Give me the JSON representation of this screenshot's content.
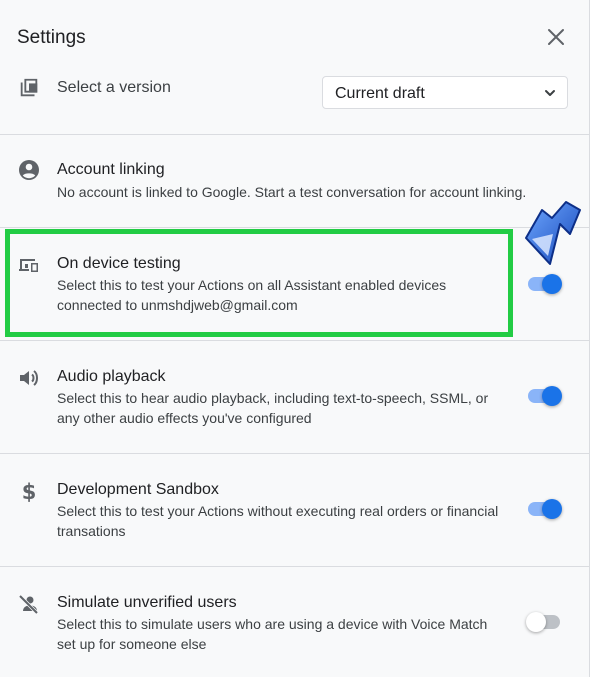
{
  "dialog": {
    "title": "Settings"
  },
  "version": {
    "label": "Select a version",
    "selected": "Current draft"
  },
  "settings": [
    {
      "title": "Account linking",
      "description": "No account is linked to Google. Start a test conversation for account linking.",
      "icon": "account-circle-icon"
    },
    {
      "title": "On device testing",
      "description": "Select this to test your Actions on all Assistant enabled devices connected to unmshdjweb@gmail.com",
      "icon": "devices-icon",
      "enabled": true
    },
    {
      "title": "Audio playback",
      "description": "Select this to hear audio playback, including text-to-speech, SSML, or any other audio effects you've configured",
      "icon": "volume-icon",
      "enabled": true
    },
    {
      "title": "Development Sandbox",
      "description": "Select this to test your Actions without executing real orders or financial transations",
      "icon": "dollar-icon",
      "enabled": true
    },
    {
      "title": "Simulate unverified users",
      "description": "Select this to simulate users who are using a device with Voice Match set up for someone else",
      "icon": "person-off-icon",
      "enabled": false
    }
  ],
  "colors": {
    "toggle_on_track": "#8ab4f8",
    "toggle_on_knob": "#1a73e8",
    "toggle_off_track": "#bdc1c6",
    "toggle_off_knob": "#ffffff",
    "highlight": "#22cc44",
    "arrow": "#1a5fd6"
  }
}
